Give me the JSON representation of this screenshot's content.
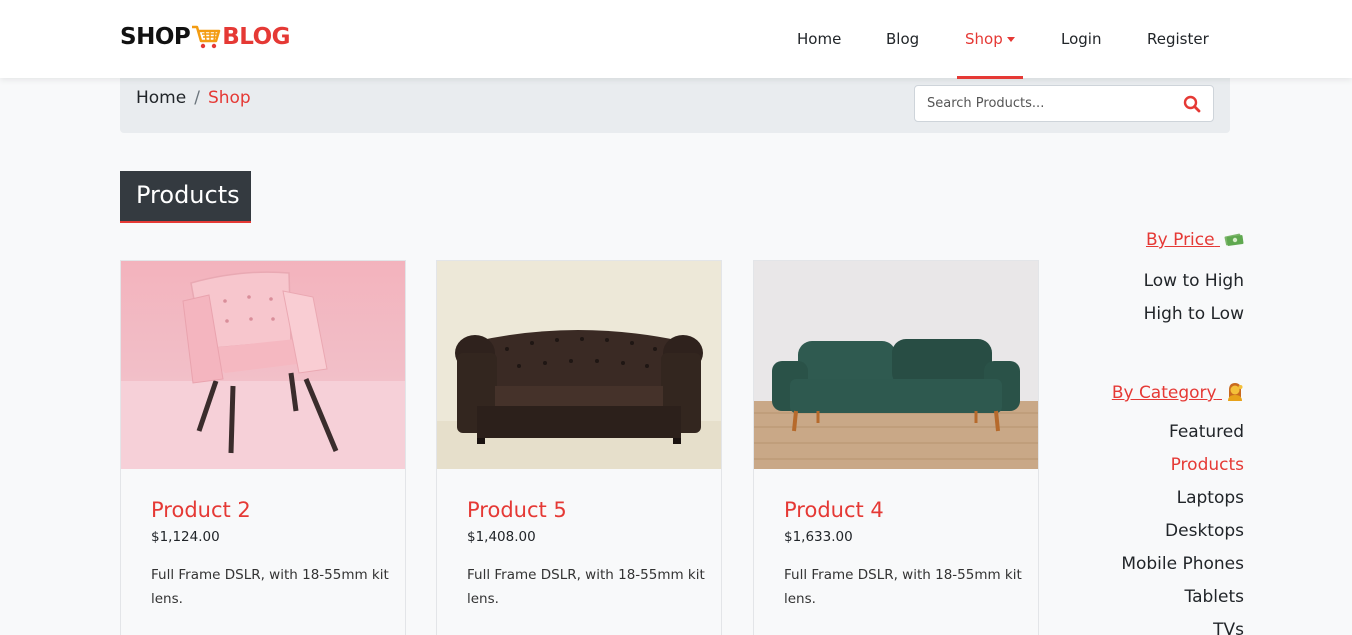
{
  "brand": {
    "part1": "SHOP",
    "part2": "BLOG"
  },
  "nav": {
    "home": "Home",
    "blog": "Blog",
    "shop": "Shop",
    "login": "Login",
    "register": "Register"
  },
  "breadcrumb": {
    "home": "Home",
    "separator": "/",
    "current": "Shop"
  },
  "search": {
    "placeholder": "Search Products..."
  },
  "page_title": "Products",
  "products": [
    {
      "title": "Product 2",
      "price": "$1,124.00",
      "desc": "Full Frame DSLR, with 18-55mm kit lens."
    },
    {
      "title": "Product 5",
      "price": "$1,408.00",
      "desc": "Full Frame DSLR, with 18-55mm kit lens."
    },
    {
      "title": "Product 4",
      "price": "$1,633.00",
      "desc": "Full Frame DSLR, with 18-55mm kit lens."
    }
  ],
  "sidebar": {
    "by_price": "By Price",
    "price_options": [
      "Low to High",
      "High to Low"
    ],
    "by_category": "By Category",
    "categories": [
      "Featured",
      "Products",
      "Laptops",
      "Desktops",
      "Mobile Phones",
      "Tablets",
      "TVs"
    ],
    "active_category": "Products"
  },
  "colors": {
    "accent": "#e53935",
    "dark": "#343a40",
    "breadcrumb_bg": "#e9ecef"
  },
  "icons": {
    "cart": "cart-icon",
    "search": "search-icon",
    "money": "money-icon",
    "person": "person-icon"
  }
}
